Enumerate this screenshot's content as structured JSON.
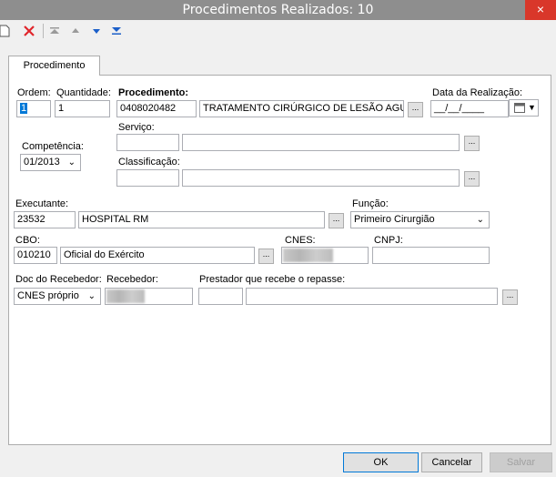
{
  "window": {
    "title": "Procedimentos Realizados: 10",
    "close_glyph": "×"
  },
  "toolbar": {
    "icons": [
      "new-icon",
      "delete-icon",
      "move-first-icon",
      "move-up-icon",
      "move-down-icon",
      "move-last-icon"
    ]
  },
  "tabs": [
    {
      "label": "Procedimento"
    }
  ],
  "form": {
    "ordem": {
      "label": "Ordem:",
      "value": "1"
    },
    "quantidade": {
      "label": "Quantidade:",
      "value": "1"
    },
    "procedimento": {
      "label": "Procedimento:",
      "code": "0408020482",
      "description": "TRATAMENTO CIRÚRGICO DE LESÃO AGUD"
    },
    "data_realizacao": {
      "label": "Data da Realização:",
      "value": "__/__/____"
    },
    "servico": {
      "label": "Serviço:",
      "code": "",
      "description": ""
    },
    "competencia": {
      "label": "Competência:",
      "value": "01/2013"
    },
    "classificacao": {
      "label": "Classificação:",
      "code": "",
      "description": ""
    },
    "executante": {
      "label": "Executante:",
      "code": "23532",
      "name": "HOSPITAL RM"
    },
    "funcao": {
      "label": "Função:",
      "value": "Primeiro Cirurgião"
    },
    "cbo": {
      "label": "CBO:",
      "code": "010210",
      "description": "Oficial do Exército"
    },
    "cnes": {
      "label": "CNES:"
    },
    "cnpj": {
      "label": "CNPJ:",
      "value": ""
    },
    "doc_recebedor": {
      "label": "Doc do Recebedor:",
      "value": "CNES próprio"
    },
    "recebedor": {
      "label": "Recebedor:"
    },
    "prestador": {
      "label": "Prestador que recebe o repasse:",
      "code": "",
      "name": ""
    },
    "ellipsis": "..."
  },
  "buttons": {
    "ok": "OK",
    "cancel": "Cancelar",
    "save": "Salvar"
  }
}
